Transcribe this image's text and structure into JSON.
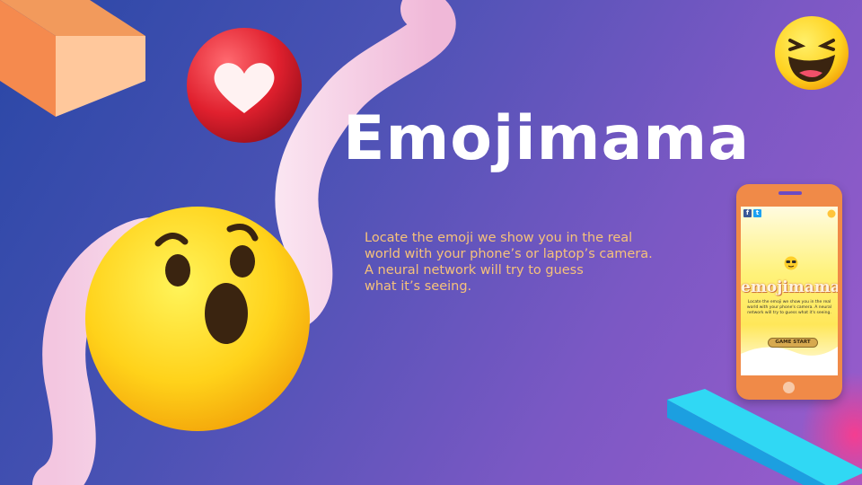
{
  "slide": {
    "title": "Emojimama",
    "description_lines": [
      "Locate the emoji we show you in the real",
      "world with your phone’s or laptop’s camera.",
      "A neural network will try to guess",
      "what it’s seeing."
    ]
  },
  "phone_mockup": {
    "app_title": "emojimama",
    "app_description": "Locate the emoji we show you in the real world with your phone's camera. A neural network will try to guess what it's seeing.",
    "start_button_label": "GAME START",
    "social_icons": [
      "facebook-icon",
      "twitter-icon"
    ]
  },
  "decorations": [
    "orange-block",
    "pink-tube",
    "heart-ball",
    "laughing-emoji",
    "surprised-emoji",
    "cyan-bar"
  ],
  "colors": {
    "background_start": "#2a47a6",
    "background_end": "#9a5ccc",
    "title": "#ffffff",
    "description": "#f6c27a",
    "phone_body": "#f08a48",
    "emoji_yellow": "#ffd21f"
  }
}
